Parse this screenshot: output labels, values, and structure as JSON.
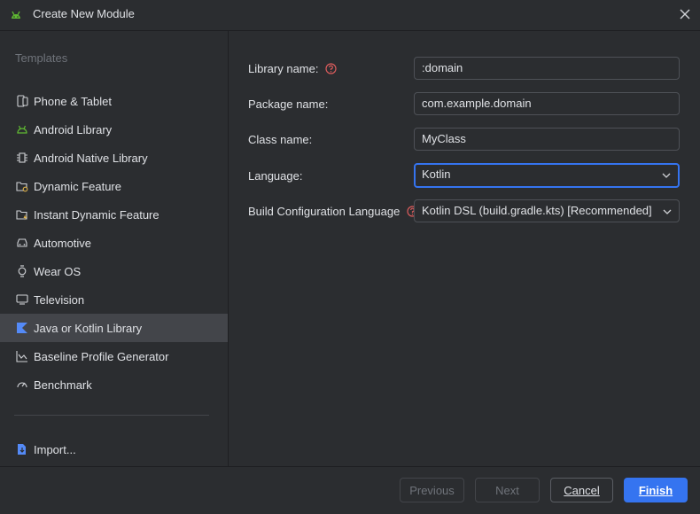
{
  "window": {
    "title": "Create New Module"
  },
  "sidebar": {
    "section_label": "Templates",
    "items": [
      {
        "label": "Phone & Tablet",
        "icon": "phone-tablet-icon"
      },
      {
        "label": "Android Library",
        "icon": "android-icon"
      },
      {
        "label": "Android Native Library",
        "icon": "chip-icon"
      },
      {
        "label": "Dynamic Feature",
        "icon": "folder-gear-icon"
      },
      {
        "label": "Instant Dynamic Feature",
        "icon": "folder-bolt-icon"
      },
      {
        "label": "Automotive",
        "icon": "car-icon"
      },
      {
        "label": "Wear OS",
        "icon": "watch-icon"
      },
      {
        "label": "Television",
        "icon": "tv-icon"
      },
      {
        "label": "Java or Kotlin Library",
        "icon": "kotlin-icon",
        "selected": true
      },
      {
        "label": "Baseline Profile Generator",
        "icon": "profile-chart-icon"
      },
      {
        "label": "Benchmark",
        "icon": "gauge-icon"
      }
    ],
    "import_label": "Import..."
  },
  "form": {
    "library_name": {
      "label": "Library name:",
      "value": ":domain"
    },
    "package_name": {
      "label": "Package name:",
      "value": "com.example.domain"
    },
    "class_name": {
      "label": "Class name:",
      "value": "MyClass"
    },
    "language": {
      "label": "Language:",
      "value": "Kotlin"
    },
    "build_config_language": {
      "label": "Build Configuration Language",
      "value": "Kotlin DSL (build.gradle.kts) [Recommended]"
    }
  },
  "footer": {
    "previous_label": "Previous",
    "next_label": "Next",
    "cancel_label": "Cancel",
    "finish_label": "Finish"
  },
  "colors": {
    "background": "#2b2d30",
    "accent": "#3574f0",
    "selected_item": "#43454a",
    "help_icon": "#db5c5c",
    "android_green": "#5fb832",
    "kotlin_blue": "#548af7"
  }
}
